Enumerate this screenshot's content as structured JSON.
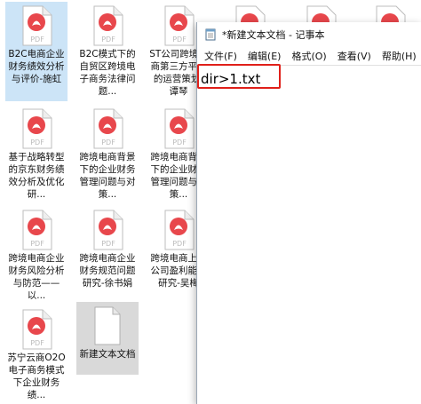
{
  "desktop": {
    "files": [
      {
        "label": "B2C电商企业财务绩效分析与评价-施虹",
        "type": "pdf",
        "icon": "pdf-icon"
      },
      {
        "label": "B2C模式下的自贸区跨境电子商务法律问题...",
        "type": "pdf",
        "icon": "pdf-icon"
      },
      {
        "label": "ST公司跨境电商第三方平台的运营策划-谭琴",
        "type": "pdf",
        "icon": "pdf-icon"
      },
      {
        "label": "基于战略转型的京东财务绩效分析及优化研...",
        "type": "pdf",
        "icon": "pdf-icon"
      },
      {
        "label": "跨境电商背景下的企业财务管理问题与对策...",
        "type": "pdf",
        "icon": "pdf-icon"
      },
      {
        "label": "跨境电商背景下的企业财务管理问题与对策...",
        "type": "pdf",
        "icon": "pdf-icon"
      },
      {
        "label": "跨境电商企业财务风险分析与防范——以...",
        "type": "pdf",
        "icon": "pdf-icon"
      },
      {
        "label": "跨境电商企业财务规范问题研究-徐书娟",
        "type": "pdf",
        "icon": "pdf-icon"
      },
      {
        "label": "跨境电商上市公司盈利能力研究-吴梅",
        "type": "pdf",
        "icon": "pdf-icon"
      },
      {
        "label": "苏宁云商O2O电子商务模式下企业财务绩...",
        "type": "pdf",
        "icon": "pdf-icon"
      },
      {
        "label": "新建文本文档",
        "type": "txt",
        "icon": "text-file-icon"
      }
    ],
    "pdf_badge": "PDF"
  },
  "notepad": {
    "title": "*新建文本文档 - 记事本",
    "menus": [
      "文件(F)",
      "编辑(E)",
      "格式(O)",
      "查看(V)",
      "帮助(H)"
    ],
    "content": "dir>1.txt"
  },
  "colors": {
    "pdf_red": "#e8474c",
    "highlight": "#e0201a",
    "selection": "#cce4f7"
  }
}
